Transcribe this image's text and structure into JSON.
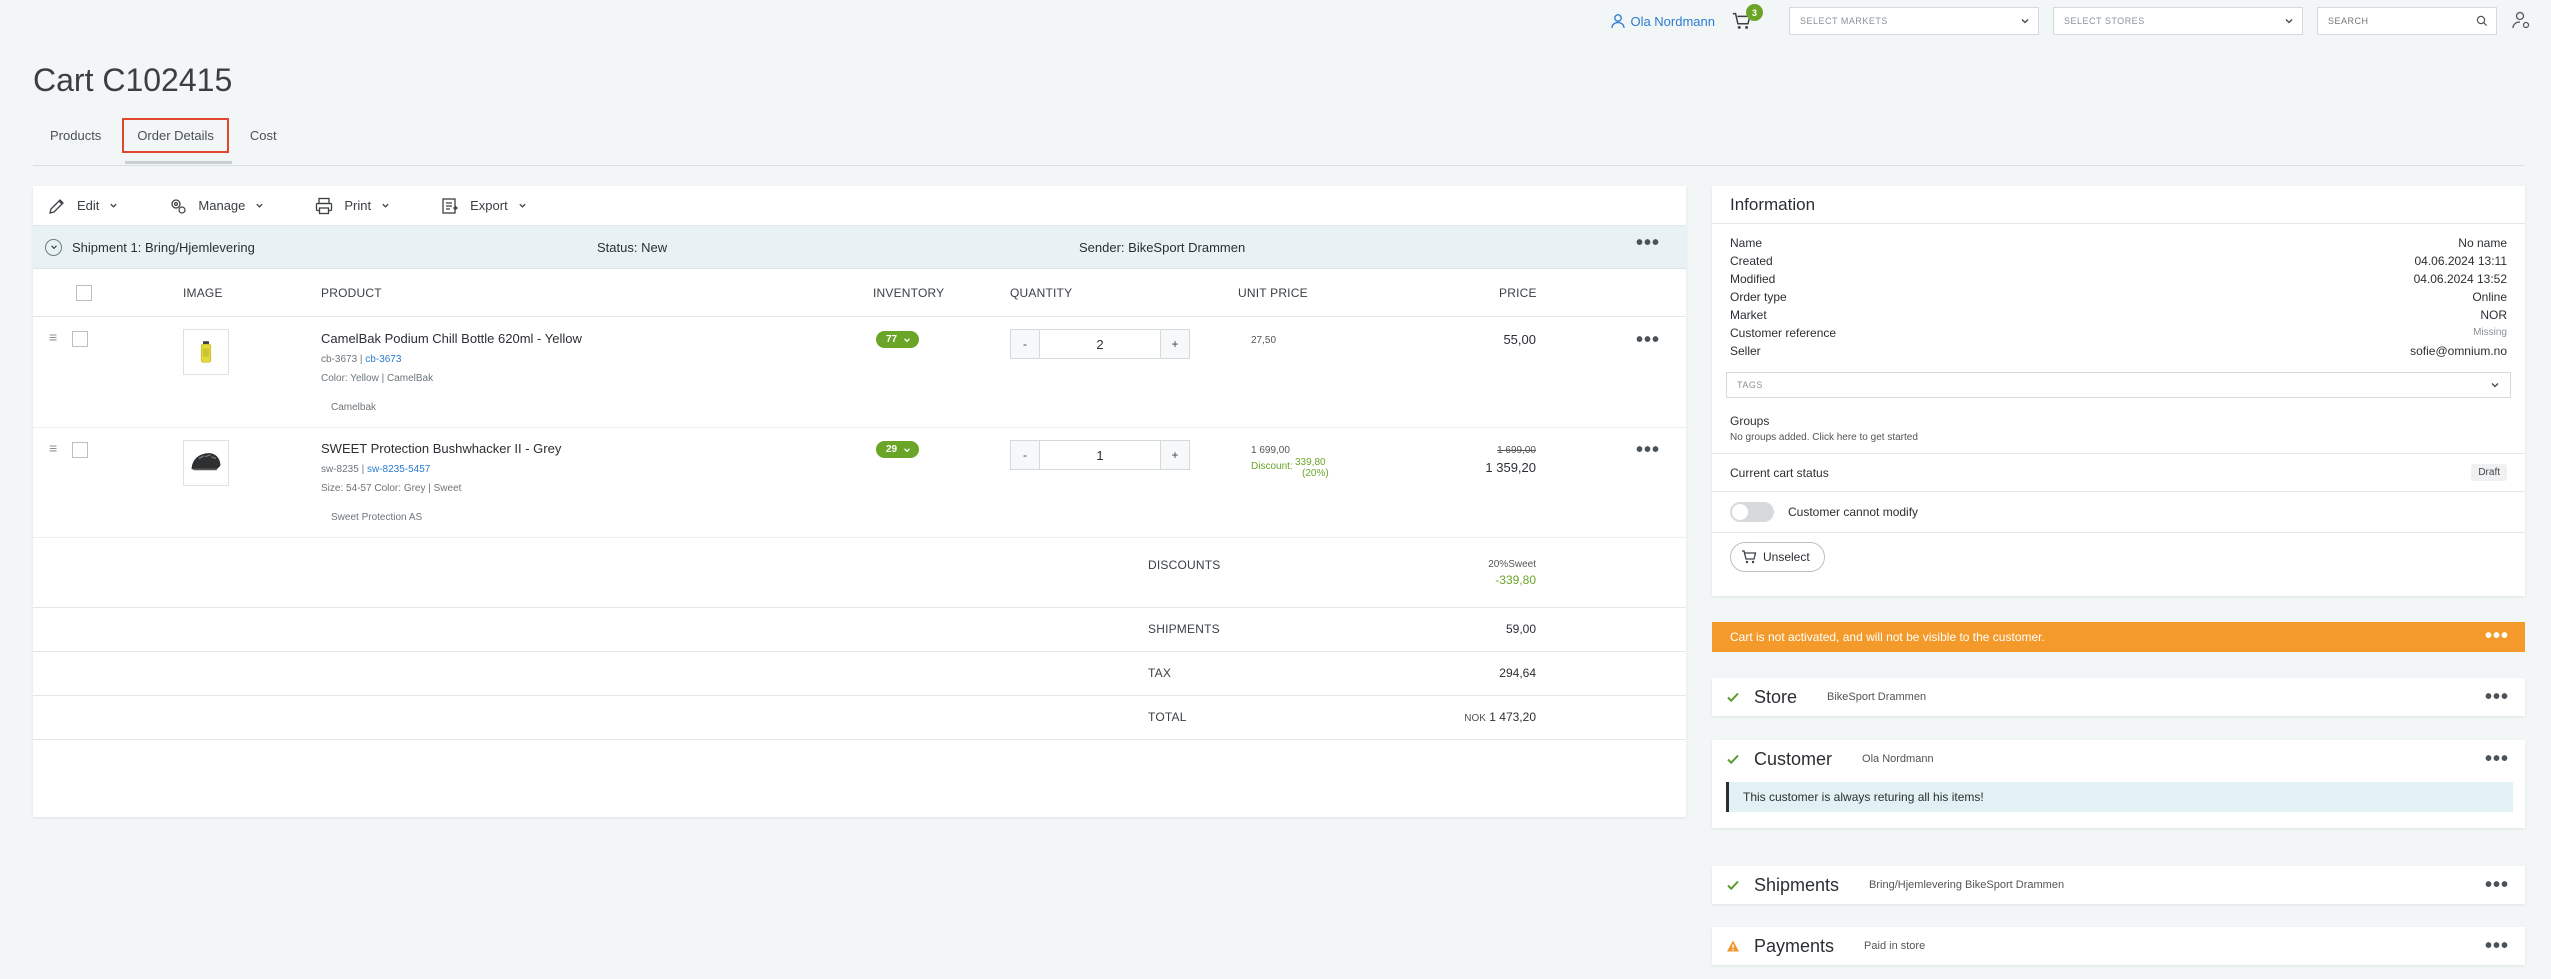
{
  "header": {
    "user_name": "Ola Nordmann",
    "cart_count": "3",
    "markets_placeholder": "SELECT MARKETS",
    "stores_placeholder": "SELECT STORES",
    "search_placeholder": "SEARCH"
  },
  "page_title": "Cart C102415",
  "tabs": [
    {
      "label": "Products"
    },
    {
      "label": "Order Details"
    },
    {
      "label": "Cost"
    }
  ],
  "toolbar": {
    "edit": "Edit",
    "manage": "Manage",
    "print": "Print",
    "export": "Export"
  },
  "shipment": {
    "title": "Shipment 1: Bring/Hjemlevering",
    "status": "Status:  New",
    "sender": "Sender: BikeSport Drammen"
  },
  "columns": {
    "image": "IMAGE",
    "product": "PRODUCT",
    "inventory": "INVENTORY",
    "quantity": "QUANTITY",
    "unit_price": "UNIT PRICE",
    "price": "PRICE"
  },
  "items": [
    {
      "name": "CamelBak Podium Chill Bottle 620ml - Yellow",
      "sku": "cb-3673",
      "sku_link": "cb-3673",
      "attrs": "Color: Yellow   |   CamelBak",
      "brand": "Camelbak",
      "inventory": "77",
      "quantity": "2",
      "unit_price": "27,50",
      "price": "55,00"
    },
    {
      "name": "SWEET Protection Bushwhacker II - Grey",
      "sku": "sw-8235",
      "sku_link": "sw-8235-5457",
      "attrs": "Size: 54-57   Color: Grey   |   Sweet",
      "brand": "Sweet Protection AS",
      "inventory": "29",
      "quantity": "1",
      "unit_price": "1 699,00",
      "discount_label": "Discount:",
      "discount_value": "339,80",
      "discount_pct": "(20%)",
      "price_old": "1 699,00",
      "price": "1 359,20"
    }
  ],
  "summary": {
    "discounts_label": "DISCOUNTS",
    "discounts_name": "20%Sweet",
    "discounts_value": "-339,80",
    "shipments_label": "SHIPMENTS",
    "shipments_value": "59,00",
    "tax_label": "TAX",
    "tax_value": "294,64",
    "total_label": "TOTAL",
    "total_currency": "NOK",
    "total_value": "1 473,20"
  },
  "info": {
    "title": "Information",
    "rows": [
      {
        "k": "Name",
        "v": "No name"
      },
      {
        "k": "Created",
        "v": "04.06.2024 13:11"
      },
      {
        "k": "Modified",
        "v": "04.06.2024 13:52"
      },
      {
        "k": "Order type",
        "v": "Online"
      },
      {
        "k": "Market",
        "v": "NOR"
      },
      {
        "k": "Customer reference",
        "v": "Missing"
      },
      {
        "k": "Seller",
        "v": "sofie@omnium.no"
      }
    ],
    "tags_placeholder": "TAGS",
    "groups_title": "Groups",
    "groups_text": "No groups added. Click here to get started",
    "cart_status_label": "Current cart status",
    "cart_status_value": "Draft",
    "customer_cannot_modify": "Customer cannot modify",
    "unselect": "Unselect"
  },
  "alert_text": "Cart is not activated, and will not be visible to the customer.",
  "cards": {
    "store_title": "Store",
    "store_sub": "BikeSport Drammen",
    "customer_title": "Customer",
    "customer_sub": "Ola Nordmann",
    "customer_note": "This customer is always returing all his items!",
    "shipments_title": "Shipments",
    "shipments_sub": "Bring/Hjemlevering BikeSport Drammen",
    "payments_title": "Payments",
    "payments_sub": "Paid in store"
  },
  "colors": {
    "accent_green": "#6aa528",
    "link_blue": "#2a7bd1",
    "alert_orange": "#f39a2b",
    "active_tab_border": "#e0472e"
  }
}
